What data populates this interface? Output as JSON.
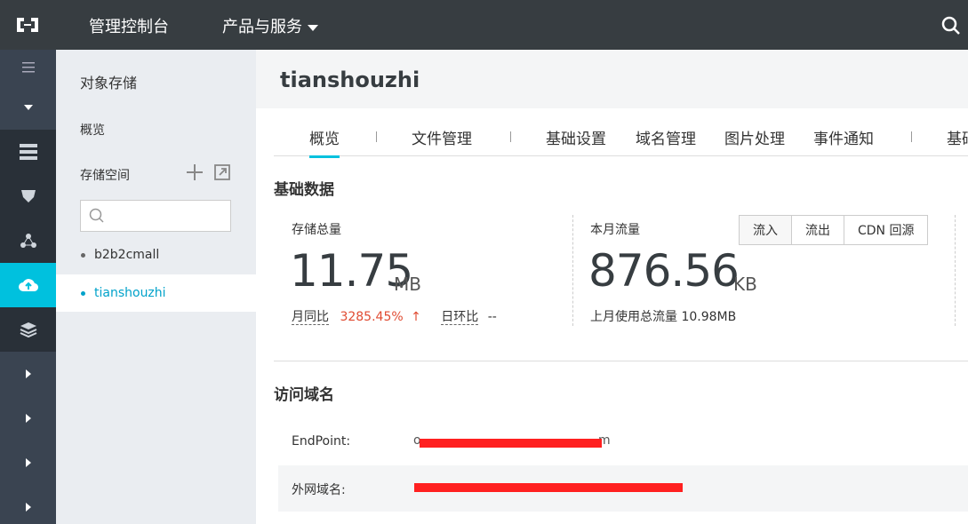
{
  "topbar": {
    "console_label": "管理控制台",
    "products_label": "产品与服务"
  },
  "sidebar": {
    "title": "对象存储",
    "overview_label": "概览",
    "storage_space_label": "存储空间",
    "buckets": [
      "b2b2cmall",
      "tianshouzhi"
    ],
    "active_bucket": "tianshouzhi"
  },
  "main": {
    "bucket_name": "tianshouzhi",
    "tabs": [
      "概览",
      "文件管理",
      "基础设置",
      "域名管理",
      "图片处理",
      "事件通知",
      "基础"
    ],
    "basic_data": {
      "title": "基础数据",
      "storage": {
        "label": "存储总量",
        "value": "11.75",
        "unit": "MB",
        "mom_label": "月同比",
        "mom_value": "3285.45%",
        "dod_label": "日环比",
        "dod_value": "--"
      },
      "traffic": {
        "label": "本月流量",
        "value": "876.56",
        "unit": "KB",
        "last_month": "上月使用总流量  10.98MB",
        "buttons": [
          "流入",
          "流出",
          "CDN 回源"
        ]
      }
    },
    "domains": {
      "title": "访问域名",
      "endpoint_label": "EndPoint:",
      "endpoint_value_visible_start": "o",
      "endpoint_value_visible_end": "m",
      "public_label": "外网域名:"
    }
  },
  "colors": {
    "topbar": "#373d41",
    "rail": "#293038",
    "accent": "#00c1de",
    "link": "#00a2ca",
    "up_red": "#e04b32",
    "redaction": "#ff2020"
  }
}
